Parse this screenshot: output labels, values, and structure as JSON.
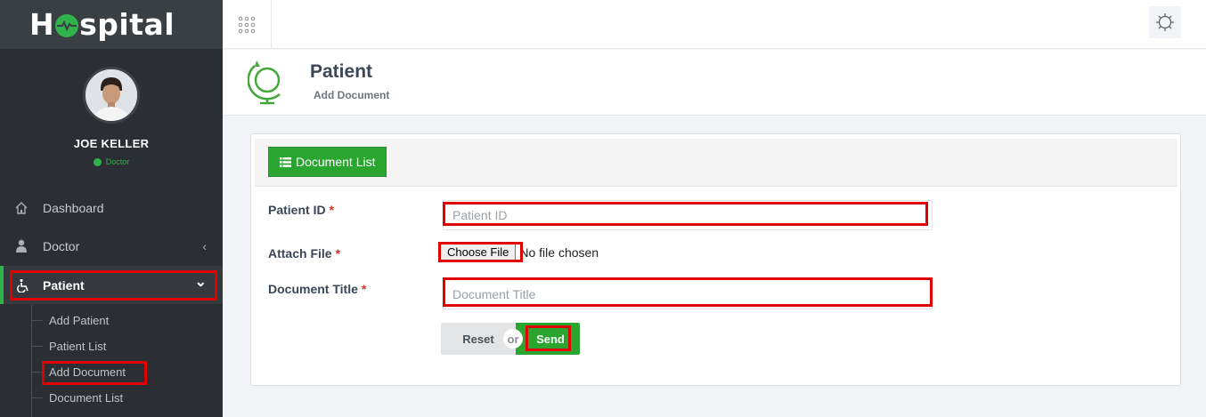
{
  "app": {
    "logo_text": "Hospital"
  },
  "sidebar": {
    "profile": {
      "name": "JOE KELLER",
      "role": "Doctor",
      "status_color": "#2fb34a"
    },
    "items": [
      {
        "label": "Dashboard",
        "icon": "home-icon"
      },
      {
        "label": "Doctor",
        "icon": "user-md-icon",
        "chevron": "‹"
      },
      {
        "label": "Patient",
        "icon": "wheelchair-icon",
        "chevron": "⌄",
        "active": true
      }
    ],
    "sub_items": [
      {
        "label": "Add Patient"
      },
      {
        "label": "Patient List"
      },
      {
        "label": "Add Document",
        "highlighted": true
      },
      {
        "label": "Document List"
      }
    ]
  },
  "topbar": {
    "menu_icon": "grid-dots-icon",
    "settings_icon": "gear-icon"
  },
  "page_header": {
    "title": "Patient",
    "subtitle": "Add Document",
    "icon": "globe-icon"
  },
  "card": {
    "list_button_label": "Document List",
    "list_button_icon": "list-icon",
    "fields": {
      "patient_id": {
        "label": "Patient ID",
        "required": "*",
        "placeholder": "Patient ID",
        "value": ""
      },
      "attach_file": {
        "label": "Attach File",
        "required": "*",
        "button_label": "Choose File",
        "status": "No file chosen"
      },
      "document_title": {
        "label": "Document Title",
        "required": "*",
        "placeholder": "Document Title",
        "value": ""
      }
    },
    "reset_label": "Reset",
    "or_label": "or",
    "send_label": "Send"
  },
  "colors": {
    "accent_green": "#2aa52f",
    "sidebar_bg": "#2b2f33",
    "highlight_red": "#e00000"
  }
}
